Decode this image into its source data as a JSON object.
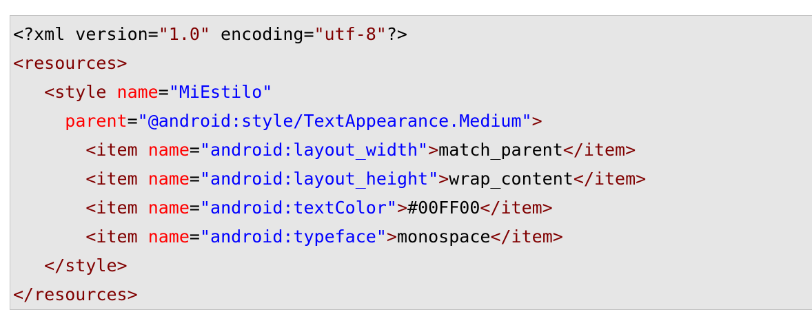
{
  "code": {
    "language": "xml",
    "colors": {
      "background": "#e6e6e6",
      "border": "#c4c4c4",
      "tag": "#800000",
      "attribute": "#ff0000",
      "value": "#0000ff",
      "text": "#000000"
    },
    "lines": [
      [
        {
          "t": "<?xml version=",
          "c": "plain"
        },
        {
          "t": "\"1.0\"",
          "c": "pi-val"
        },
        {
          "t": " encoding=",
          "c": "plain"
        },
        {
          "t": "\"utf-8\"",
          "c": "pi-val"
        },
        {
          "t": "?>",
          "c": "plain"
        }
      ],
      [
        {
          "t": "<resources>",
          "c": "tag"
        }
      ],
      [
        {
          "t": "   ",
          "c": "plain"
        },
        {
          "t": "<style",
          "c": "tag"
        },
        {
          "t": " ",
          "c": "plain"
        },
        {
          "t": "name",
          "c": "attr"
        },
        {
          "t": "=",
          "c": "plain"
        },
        {
          "t": "\"MiEstilo\"",
          "c": "val"
        }
      ],
      [
        {
          "t": "     ",
          "c": "plain"
        },
        {
          "t": "parent",
          "c": "attr"
        },
        {
          "t": "=",
          "c": "plain"
        },
        {
          "t": "\"@android:style/TextAppearance.Medium\"",
          "c": "val"
        },
        {
          "t": ">",
          "c": "tag"
        }
      ],
      [
        {
          "t": "       ",
          "c": "plain"
        },
        {
          "t": "<item",
          "c": "tag"
        },
        {
          "t": " ",
          "c": "plain"
        },
        {
          "t": "name",
          "c": "attr"
        },
        {
          "t": "=",
          "c": "plain"
        },
        {
          "t": "\"android:layout_width\"",
          "c": "val"
        },
        {
          "t": ">",
          "c": "tag"
        },
        {
          "t": "match_parent",
          "c": "plain"
        },
        {
          "t": "</item>",
          "c": "tag"
        }
      ],
      [
        {
          "t": "       ",
          "c": "plain"
        },
        {
          "t": "<item",
          "c": "tag"
        },
        {
          "t": " ",
          "c": "plain"
        },
        {
          "t": "name",
          "c": "attr"
        },
        {
          "t": "=",
          "c": "plain"
        },
        {
          "t": "\"android:layout_height\"",
          "c": "val"
        },
        {
          "t": ">",
          "c": "tag"
        },
        {
          "t": "wrap_content",
          "c": "plain"
        },
        {
          "t": "</item>",
          "c": "tag"
        }
      ],
      [
        {
          "t": "       ",
          "c": "plain"
        },
        {
          "t": "<item",
          "c": "tag"
        },
        {
          "t": " ",
          "c": "plain"
        },
        {
          "t": "name",
          "c": "attr"
        },
        {
          "t": "=",
          "c": "plain"
        },
        {
          "t": "\"android:textColor\"",
          "c": "val"
        },
        {
          "t": ">",
          "c": "tag"
        },
        {
          "t": "#00FF00",
          "c": "plain"
        },
        {
          "t": "</item>",
          "c": "tag"
        }
      ],
      [
        {
          "t": "       ",
          "c": "plain"
        },
        {
          "t": "<item",
          "c": "tag"
        },
        {
          "t": " ",
          "c": "plain"
        },
        {
          "t": "name",
          "c": "attr"
        },
        {
          "t": "=",
          "c": "plain"
        },
        {
          "t": "\"android:typeface\"",
          "c": "val"
        },
        {
          "t": ">",
          "c": "tag"
        },
        {
          "t": "monospace",
          "c": "plain"
        },
        {
          "t": "</item>",
          "c": "tag"
        }
      ],
      [
        {
          "t": "   ",
          "c": "plain"
        },
        {
          "t": "</style>",
          "c": "tag"
        }
      ],
      [
        {
          "t": "</resources>",
          "c": "tag"
        }
      ]
    ]
  }
}
